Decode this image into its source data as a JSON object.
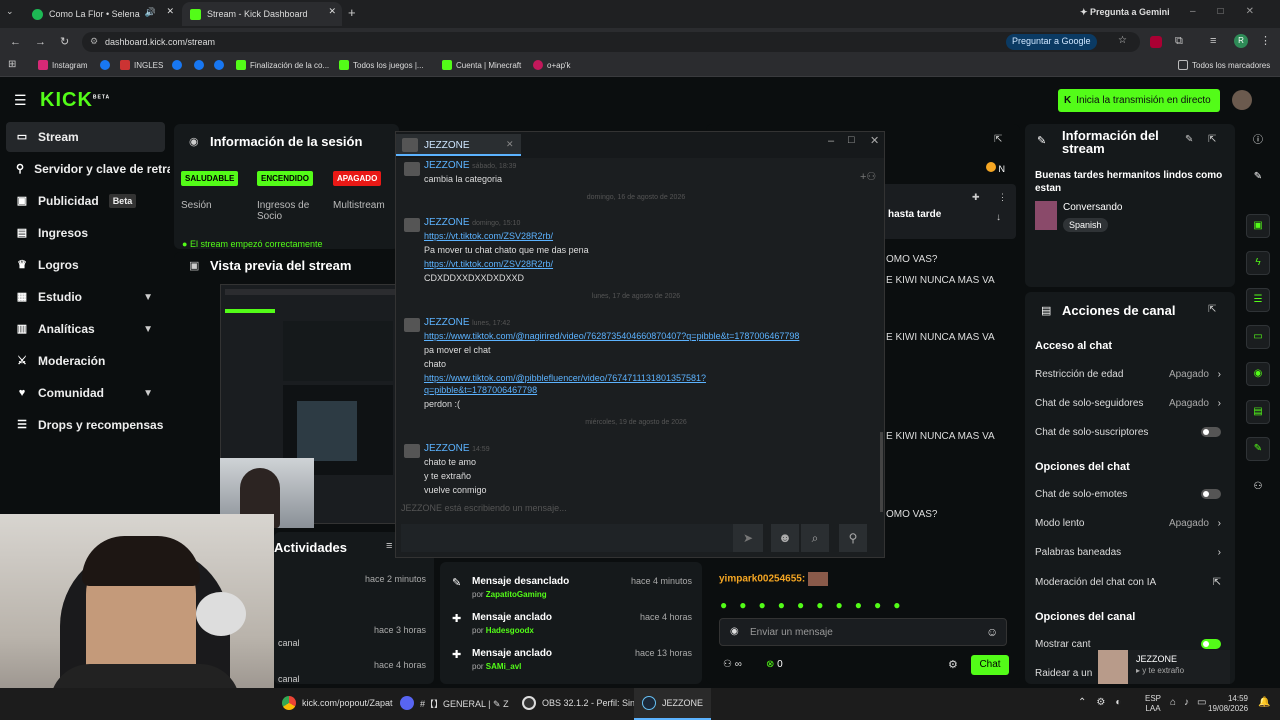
{
  "browser": {
    "tabs": [
      {
        "label": "Como La Flor • Selena"
      },
      {
        "label": "Stream - Kick Dashboard"
      }
    ],
    "gemini": "Pregunta a Gemini",
    "url": "dashboard.kick.com/stream",
    "ask_google": "Preguntar a Google",
    "profile_initial": "R",
    "bookmarks": [
      "Instagram",
      "INGLES",
      "Finalización de la co...",
      "Todos los juegos |...",
      "Cuenta | Minecraft",
      "o+ap'k"
    ],
    "all_bookmarks": "Todos los marcadores"
  },
  "kick": {
    "logo": "KICK",
    "beta": "BETA",
    "go_live": "Inicia la transmisión en directo",
    "sidebar": [
      {
        "label": "Stream"
      },
      {
        "label": "Servidor y clave de retransmisión"
      },
      {
        "label": "Publicidad",
        "badge": "Beta"
      },
      {
        "label": "Ingresos"
      },
      {
        "label": "Logros"
      },
      {
        "label": "Estudio"
      },
      {
        "label": "Analíticas"
      },
      {
        "label": "Moderación"
      },
      {
        "label": "Comunidad"
      },
      {
        "label": "Drops y recompensas"
      }
    ],
    "session": {
      "title": "Información de la sesión",
      "statuses": [
        {
          "pill": "SALUDABLE",
          "label": "Sesión"
        },
        {
          "pill": "ENCENDIDO",
          "label": "Ingresos de Socio"
        },
        {
          "pill": "APAGADO",
          "label": "Multistream"
        }
      ],
      "started": "El stream empezó correctamente"
    },
    "preview": {
      "title": "Vista previa del stream"
    },
    "activity": {
      "title": "Actividades",
      "times": [
        "hace 2 minutos",
        "hace 3 horas",
        "hace 4 horas"
      ],
      "frag": "canal"
    },
    "pinned": [
      {
        "title": "Mensaje desanclado",
        "by": "ZapatitoGaming",
        "time": "hace 4 minutos"
      },
      {
        "title": "Mensaje anclado",
        "by": "Hadesgoodx",
        "time": "hace 4 horas"
      },
      {
        "title": "Mensaje anclado",
        "by": "SAMi_avl",
        "time": "hace 13 horas"
      }
    ],
    "chat": {
      "pinned_fragment": "hasta tarde",
      "lines": [
        "OMO VAS?",
        "E KIWI NUNCA MAS VA",
        "E KIWI NUNCA MAS VA",
        "E KIWI NUNCA MAS VA",
        "OMO VAS?"
      ],
      "last_user": "yimpark00254655:",
      "input_placeholder": "Enviar un mensaje",
      "count": "0",
      "send": "Chat",
      "badge_n": "N"
    },
    "stream_info": {
      "title": "Información del stream",
      "text": "Buenas tardes hermanitos lindos como estan",
      "category": "Conversando",
      "language": "Spanish"
    },
    "actions": {
      "title": "Acciones de canal",
      "access": "Acceso al chat",
      "age": "Restricción de edad",
      "age_val": "Apagado",
      "followers": "Chat de solo-seguidores",
      "followers_val": "Apagado",
      "subs": "Chat de solo-suscriptores",
      "chat_opts": "Opciones del chat",
      "emotes": "Chat de solo-emotes",
      "slow": "Modo lento",
      "slow_val": "Apagado",
      "banned": "Palabras baneadas",
      "ai_mod": "Moderación del chat con IA",
      "channel_opts": "Opciones del canal",
      "show": "Mostrar cant",
      "raid": "Raidear a un"
    }
  },
  "popup": {
    "name": "JEZZONE",
    "typing": "JEZZONE está escribiendo un mensaje...",
    "messages": [
      {
        "user": "JEZZONE",
        "time": "sábado, 18:39",
        "lines": [
          "cambia la categoria"
        ]
      },
      {
        "sep": "domingo, 16 de agosto de 2026"
      },
      {
        "user": "JEZZONE",
        "time": "domingo, 15:10",
        "link1": "https://vt.tiktok.com/ZSV28R2rb/",
        "text1": "Pa mover tu chat chato que me das pena",
        "link2": "https://vt.tiktok.com/ZSV28R2rb/",
        "text2": "CDXDDXXDXXDXDXXD"
      },
      {
        "sep": "lunes, 17 de agosto de 2026"
      },
      {
        "user": "JEZZONE",
        "time": "lunes, 17:42",
        "link1": "https://www.tiktok.com/@nagirired/video/7628735404660870407?q=pibble&t=1787006467798",
        "text1": "pa mover el chat",
        "text2": "chato",
        "link2a": "https://www.tiktok.com/@pibblefluencer/video/7674711131801357581?",
        "link2b": "q=pibble&t=1787006467798",
        "text3": "perdon :("
      },
      {
        "sep": "miércoles, 19 de agosto de 2026"
      },
      {
        "user": "JEZZONE",
        "time": "14:59",
        "lines": [
          "chato te amo",
          "y te extraño",
          "vuelve conmigo"
        ]
      }
    ]
  },
  "notification": {
    "name": "JEZZONE",
    "text": "y te extraño"
  },
  "taskbar": {
    "items": [
      "kick.com/popout/Zapat",
      "#【】GENERAL | ✎ Z",
      "OBS 32.1.2 - Perfil: Sin Tí",
      "JEZZONE"
    ],
    "lang1": "ESP",
    "lang2": "LAA",
    "time": "14:59",
    "date": "19/08/2026"
  },
  "colors": {
    "kick_green": "#53fc18",
    "healthy": "#53fc18",
    "off": "#e91916",
    "link": "#5cb3ff"
  }
}
